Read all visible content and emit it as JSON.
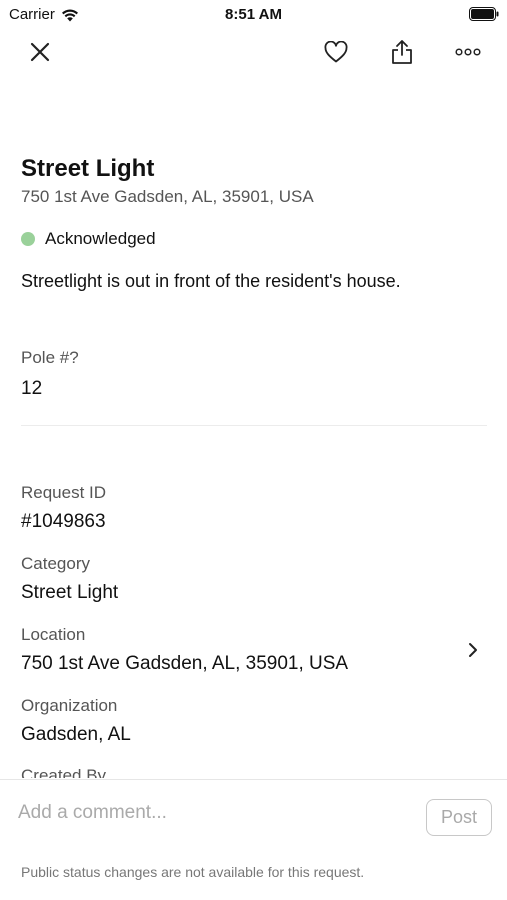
{
  "status_bar": {
    "carrier": "Carrier",
    "time": "8:51 AM"
  },
  "nav": {
    "close_icon": "close-icon",
    "favorite_icon": "heart-icon",
    "share_icon": "share-icon",
    "more_icon": "more-icon"
  },
  "request": {
    "title": "Street Light",
    "address": "750 1st Ave Gadsden, AL, 35901, USA",
    "status": "Acknowledged",
    "status_color": "#9ad19a",
    "description": "Streetlight is out in front of the resident's house."
  },
  "custom_field": {
    "label": "Pole #?",
    "value": "12"
  },
  "details": {
    "request_id_label": "Request ID",
    "request_id_value": "#1049863",
    "category_label": "Category",
    "category_value": "Street Light",
    "location_label": "Location",
    "location_value": "750 1st Ave Gadsden, AL, 35901, USA",
    "organization_label": "Organization",
    "organization_value": "Gadsden, AL",
    "created_by_label": "Created By"
  },
  "comment": {
    "placeholder": "Add a comment...",
    "post_label": "Post",
    "footnote": "Public status changes are not available for this request."
  }
}
